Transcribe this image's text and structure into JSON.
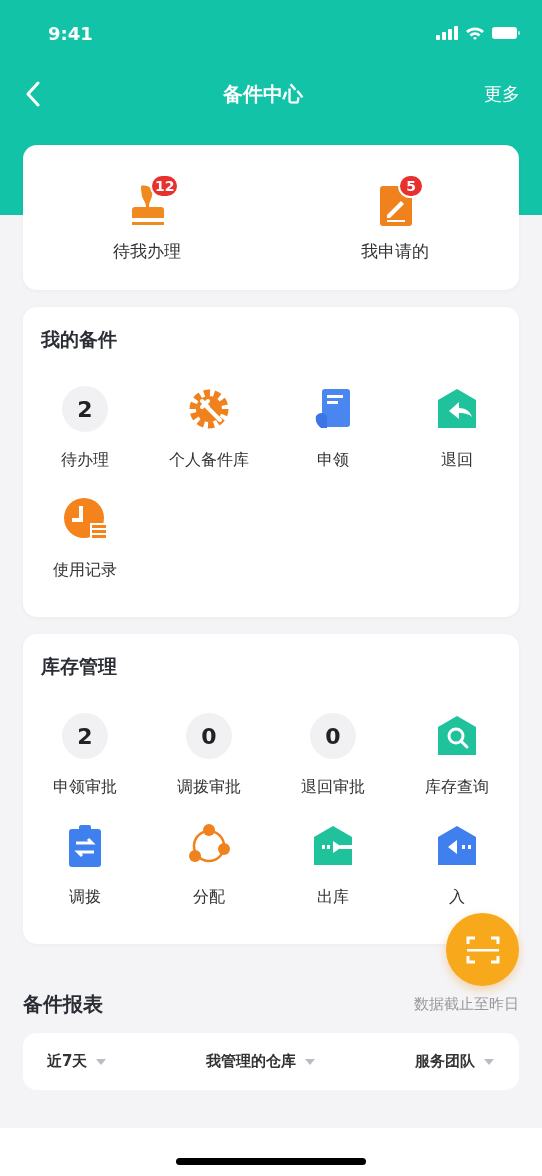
{
  "status_bar": {
    "time": "9:41"
  },
  "nav": {
    "title": "备件中心",
    "more": "更多"
  },
  "summary": [
    {
      "kind": "stamp",
      "label": "待我办理",
      "badge": "12"
    },
    {
      "kind": "form",
      "label": "我申请的",
      "badge": "5"
    }
  ],
  "sections": [
    {
      "title": "我的备件",
      "items": [
        {
          "kind": "count",
          "count": "2",
          "label": "待办理"
        },
        {
          "kind": "gear",
          "label": "个人备件库"
        },
        {
          "kind": "book",
          "label": "申领"
        },
        {
          "kind": "return",
          "label": "退回"
        },
        {
          "kind": "clock",
          "label": "使用记录"
        }
      ]
    },
    {
      "title": "库存管理",
      "items": [
        {
          "kind": "count",
          "count": "2",
          "label": "申领审批"
        },
        {
          "kind": "count",
          "count": "0",
          "label": "调拨审批"
        },
        {
          "kind": "count",
          "count": "0",
          "label": "退回审批"
        },
        {
          "kind": "query",
          "label": "库存查询"
        },
        {
          "kind": "transfer",
          "label": "调拨"
        },
        {
          "kind": "share",
          "label": "分配"
        },
        {
          "kind": "outbound",
          "label": "出库"
        },
        {
          "kind": "inbound",
          "label": "入"
        }
      ]
    }
  ],
  "report": {
    "title": "备件报表",
    "note": "数据截止至昨日",
    "filters": [
      {
        "label": "近7天"
      },
      {
        "label": "我管理的仓库"
      },
      {
        "label": "服务团队"
      }
    ]
  }
}
